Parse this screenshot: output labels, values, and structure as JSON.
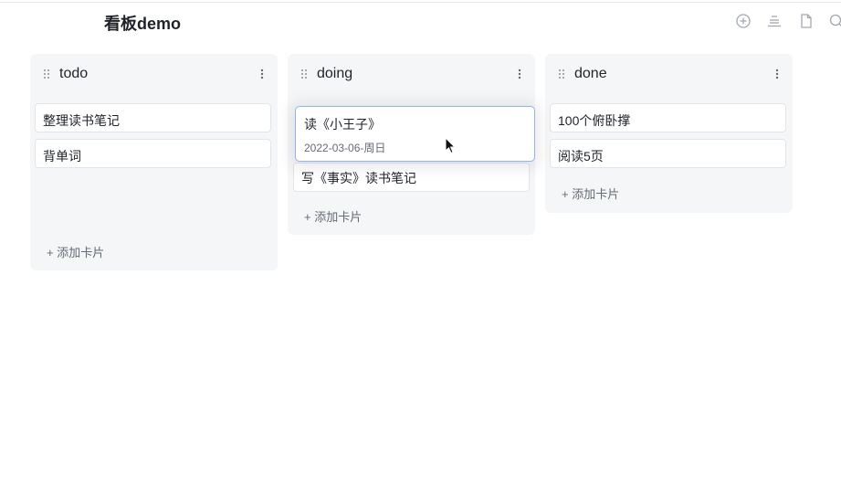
{
  "page": {
    "title": "看板demo"
  },
  "toolbar": {
    "icons": [
      "add-circle-icon",
      "align-center-icon",
      "document-icon",
      "search-icon"
    ]
  },
  "columns": [
    {
      "title": "todo",
      "cards": [
        {
          "title": "整理读书笔记"
        },
        {
          "title": "背单词"
        }
      ],
      "add_label": "+ 添加卡片"
    },
    {
      "title": "doing",
      "cards": [
        {
          "title": "写《事实》读书笔记"
        }
      ],
      "add_label": "+ 添加卡片"
    },
    {
      "title": "done",
      "cards": [
        {
          "title": "100个俯卧撑"
        },
        {
          "title": "阅读5页"
        }
      ],
      "add_label": "+ 添加卡片"
    }
  ],
  "dragging_card": {
    "title": "读《小王子》",
    "date": "2022-03-06-周日"
  },
  "colors": {
    "accent": "#8fb4f2",
    "column_bg": "#f5f6f8",
    "muted_text": "#646a73"
  }
}
